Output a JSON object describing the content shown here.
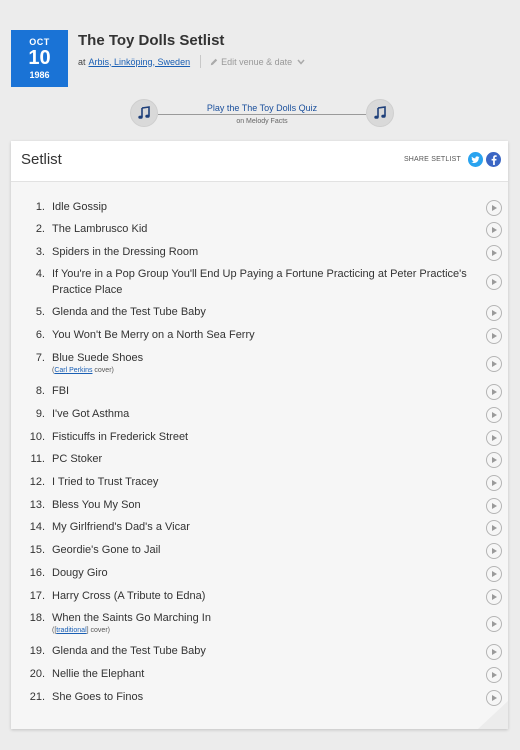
{
  "date": {
    "month": "OCT",
    "day": "10",
    "year": "1986"
  },
  "title": "The Toy Dolls Setlist",
  "venue": {
    "prefix": "at",
    "name": "Arbis, Linköping, Sweden"
  },
  "edit_label": "Edit venue & date",
  "quiz": {
    "link": "Play the The Toy Dolls Quiz",
    "sub": "on Melody Facts"
  },
  "setlist": {
    "heading": "Setlist",
    "share_label": "SHARE SETLIST",
    "songs": [
      {
        "num": "1.",
        "name": "Idle Gossip"
      },
      {
        "num": "2.",
        "name": "The Lambrusco Kid"
      },
      {
        "num": "3.",
        "name": "Spiders in the Dressing Room"
      },
      {
        "num": "4.",
        "name": "If You're in a Pop Group You'll End Up Paying a Fortune Practicing at Peter Practice's Practice Place"
      },
      {
        "num": "5.",
        "name": "Glenda and the Test Tube Baby"
      },
      {
        "num": "6.",
        "name": "You Won't Be Merry on a North Sea Ferry"
      },
      {
        "num": "7.",
        "name": "Blue Suede Shoes",
        "info_open": "(",
        "info_link": "Carl Perkins",
        "info_close": " cover)"
      },
      {
        "num": "8.",
        "name": "FBI"
      },
      {
        "num": "9.",
        "name": "I've Got Asthma"
      },
      {
        "num": "10.",
        "name": "Fisticuffs in Frederick Street"
      },
      {
        "num": "11.",
        "name": "PC Stoker"
      },
      {
        "num": "12.",
        "name": "I Tried to Trust Tracey"
      },
      {
        "num": "13.",
        "name": "Bless You My Son"
      },
      {
        "num": "14.",
        "name": "My Girlfriend's Dad's a Vicar"
      },
      {
        "num": "15.",
        "name": "Geordie's Gone to Jail"
      },
      {
        "num": "16.",
        "name": "Dougy Giro"
      },
      {
        "num": "17.",
        "name": "Harry Cross (A Tribute to Edna)"
      },
      {
        "num": "18.",
        "name": "When the Saints Go Marching In",
        "info_open": "([",
        "info_link": "traditional",
        "info_close": "] cover)"
      },
      {
        "num": "19.",
        "name": "Glenda and the Test Tube Baby"
      },
      {
        "num": "20.",
        "name": "Nellie the Elephant"
      },
      {
        "num": "21.",
        "name": "She Goes to Finos"
      }
    ]
  }
}
